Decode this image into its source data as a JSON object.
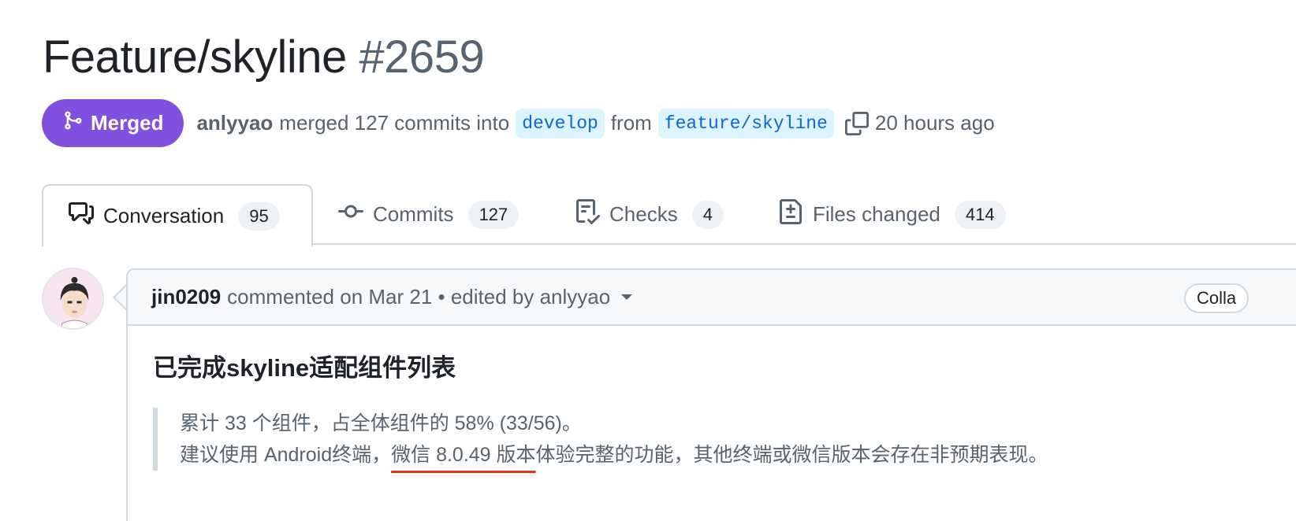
{
  "pr": {
    "title": "Feature/skyline",
    "number": "#2659",
    "state": "Merged",
    "author": "anlyyao",
    "merged_text": "merged 127 commits into",
    "base_branch": "develop",
    "from_text": "from",
    "head_branch": "feature/skyline",
    "time_ago": "20 hours ago"
  },
  "tabs": [
    {
      "label": "Conversation",
      "count": "95"
    },
    {
      "label": "Commits",
      "count": "127"
    },
    {
      "label": "Checks",
      "count": "4"
    },
    {
      "label": "Files changed",
      "count": "414"
    }
  ],
  "comment": {
    "author": "jin0209",
    "meta": "commented on Mar 21 • edited by anlyyao",
    "collapse_label": "Colla",
    "heading": "已完成skyline适配组件列表",
    "quote_line1": "累计 33 个组件，占全体组件的 58% (33/56)。",
    "quote_line2_prefix": "建议使用 Android终端，",
    "quote_line2_underlined": "微信 8.0.49 版本",
    "quote_line2_suffix": "体验完整的功能，其他终端或微信版本会存在非预期表现。"
  },
  "colors": {
    "merged_purple": "#8250df",
    "branch_blue": "#0969da",
    "branch_bg": "#ddf4ff",
    "annotation_red": "#e0321e"
  }
}
